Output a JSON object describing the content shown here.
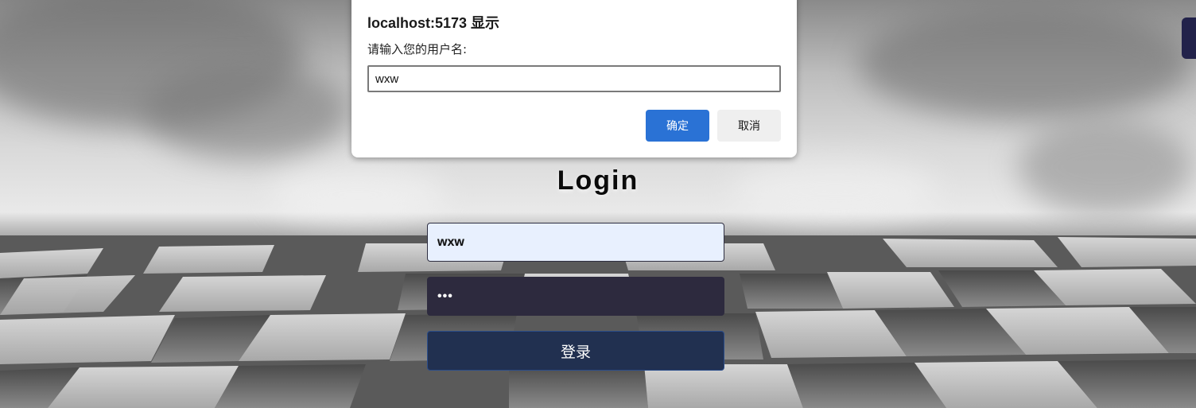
{
  "dialog": {
    "title": "localhost:5173 显示",
    "message": "请输入您的用户名:",
    "input_value": "wxw",
    "ok_label": "确定",
    "cancel_label": "取消"
  },
  "login": {
    "title": "Login",
    "username_value": "wxw",
    "password_value": "•••",
    "submit_label": "登录"
  },
  "colors": {
    "ok_button": "#2a72d5",
    "login_button": "#213050",
    "password_field": "#2d2a3e",
    "username_field": "#e8f0fe",
    "side_tab": "#22224a"
  }
}
